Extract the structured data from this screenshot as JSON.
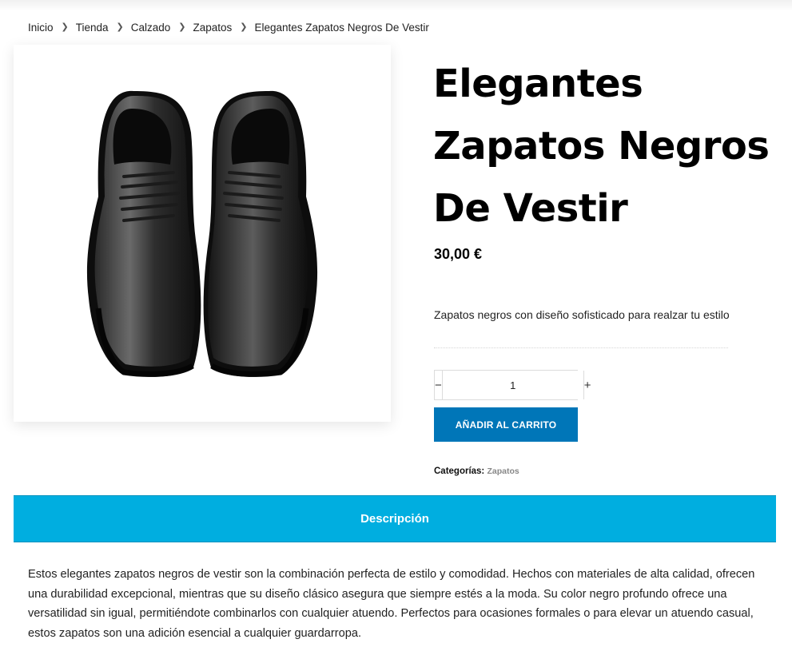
{
  "breadcrumb": {
    "items": [
      "Inicio",
      "Tienda",
      "Calzado",
      "Zapatos",
      "Elegantes Zapatos Negros De Vestir"
    ]
  },
  "product": {
    "title_lines": [
      "Elegantes",
      "Zapatos Negros",
      "De Vestir"
    ],
    "price": "30,00 €",
    "short_description": "Zapatos negros con diseño sofisticado para realzar tu estilo",
    "quantity": "1",
    "add_to_cart_label": "AÑADIR AL CARRITO",
    "categories_label": "Categorías:",
    "category": "Zapatos",
    "image_icon": "shoe-image"
  },
  "tabs": {
    "description_label": "Descripción"
  },
  "description": {
    "text": "Estos elegantes zapatos negros de vestir son la combinación perfecta de estilo y comodidad. Hechos con materiales de alta calidad, ofrecen una durabilidad excepcional, mientras que su diseño clásico asegura que siempre estés a la moda. Su color negro profundo ofrece una versatilidad sin igual, permitiéndote combinarlos con cualquier atuendo. Perfectos para ocasiones formales o para elevar un atuendo casual, estos zapatos son una adición esencial a cualquier guardarropa."
  },
  "colors": {
    "button": "#0076b8",
    "tab_bar": "#00aee0"
  }
}
